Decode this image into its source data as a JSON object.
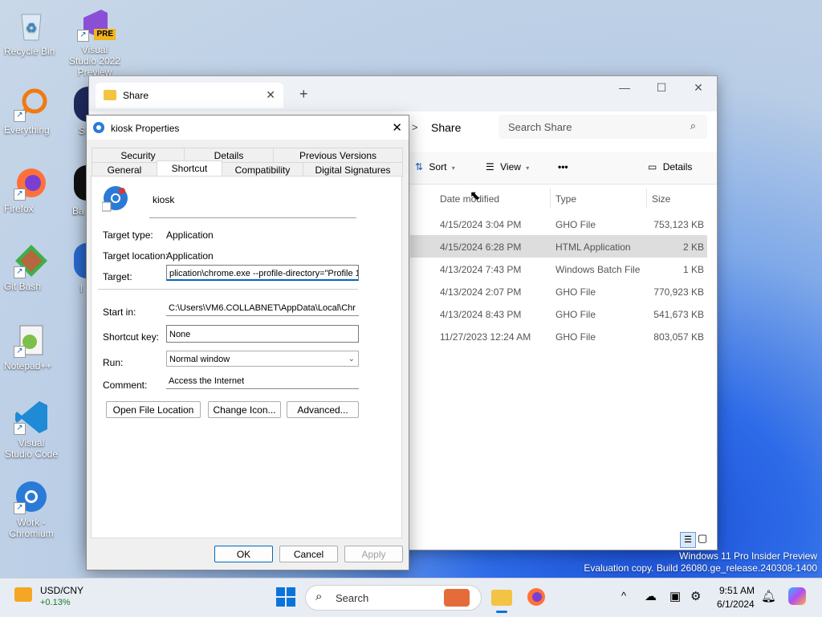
{
  "desktop": {
    "icons": [
      {
        "label": "Recycle Bin"
      },
      {
        "label": "Visual Studio 2022 Preview",
        "badge": "PRE"
      },
      {
        "label": "Everything"
      },
      {
        "label": "Firefox"
      },
      {
        "label": "Git Bash"
      },
      {
        "label": "Notepad++"
      },
      {
        "label": "Visual Studio Code"
      },
      {
        "label": "Work - Chromium"
      }
    ],
    "partial_labels": [
      "S",
      "Ba",
      "l"
    ]
  },
  "explorer": {
    "tab_title": "Share",
    "new_tab": "+",
    "breadcrumb_sep": ">",
    "breadcrumb": "Share",
    "search_placeholder": "Search Share",
    "toolbar": {
      "sort": "Sort",
      "view": "View",
      "more": "•••",
      "details": "Details"
    },
    "columns": {
      "date": "Date modified",
      "type": "Type",
      "size": "Size"
    },
    "rows": [
      {
        "date": "4/15/2024 3:04 PM",
        "type": "GHO File",
        "size": "753,123 KB"
      },
      {
        "date": "4/15/2024 6:28 PM",
        "type": "HTML Application",
        "size": "2 KB",
        "selected": true
      },
      {
        "date": "4/13/2024 7:43 PM",
        "type": "Windows Batch File",
        "size": "1 KB"
      },
      {
        "date": "4/13/2024 2:07 PM",
        "type": "GHO File",
        "size": "770,923 KB"
      },
      {
        "date": "4/13/2024 8:43 PM",
        "type": "GHO File",
        "size": "541,673 KB"
      },
      {
        "date": "11/27/2023 12:24 AM",
        "type": "GHO File",
        "size": "803,057 KB"
      }
    ]
  },
  "dialog": {
    "title": "kiosk Properties",
    "tabs_top": [
      "Security",
      "Details",
      "Previous Versions"
    ],
    "tabs_bottom": [
      "General",
      "Shortcut",
      "Compatibility",
      "Digital Signatures"
    ],
    "name": "kiosk",
    "target_type_label": "Target type:",
    "target_type": "Application",
    "target_location_label": "Target location:",
    "target_location": "Application",
    "target_label": "Target:",
    "target": "plication\\chrome.exe --profile-directory=\"Profile 1\"",
    "start_in_label": "Start in:",
    "start_in": "C:\\Users\\VM6.COLLABNET\\AppData\\Local\\Chr",
    "shortcut_key_label": "Shortcut key:",
    "shortcut_key": "None",
    "run_label": "Run:",
    "run": "Normal window",
    "comment_label": "Comment:",
    "comment": "Access the Internet",
    "btn_open_location": "Open File Location",
    "btn_change_icon": "Change Icon...",
    "btn_advanced": "Advanced...",
    "btn_ok": "OK",
    "btn_cancel": "Cancel",
    "btn_apply": "Apply"
  },
  "watermark": {
    "line1": "Windows 11 Pro Insider Preview",
    "line2": "Evaluation copy. Build 26080.ge_release.240308-1400"
  },
  "taskbar": {
    "stock_name": "USD/CNY",
    "stock_change": "+0.13%",
    "search_placeholder": "Search",
    "time": "9:51 AM",
    "date": "6/1/2024"
  },
  "colors": {
    "accent": "#0067c0",
    "selected_row": "#dddddd"
  }
}
